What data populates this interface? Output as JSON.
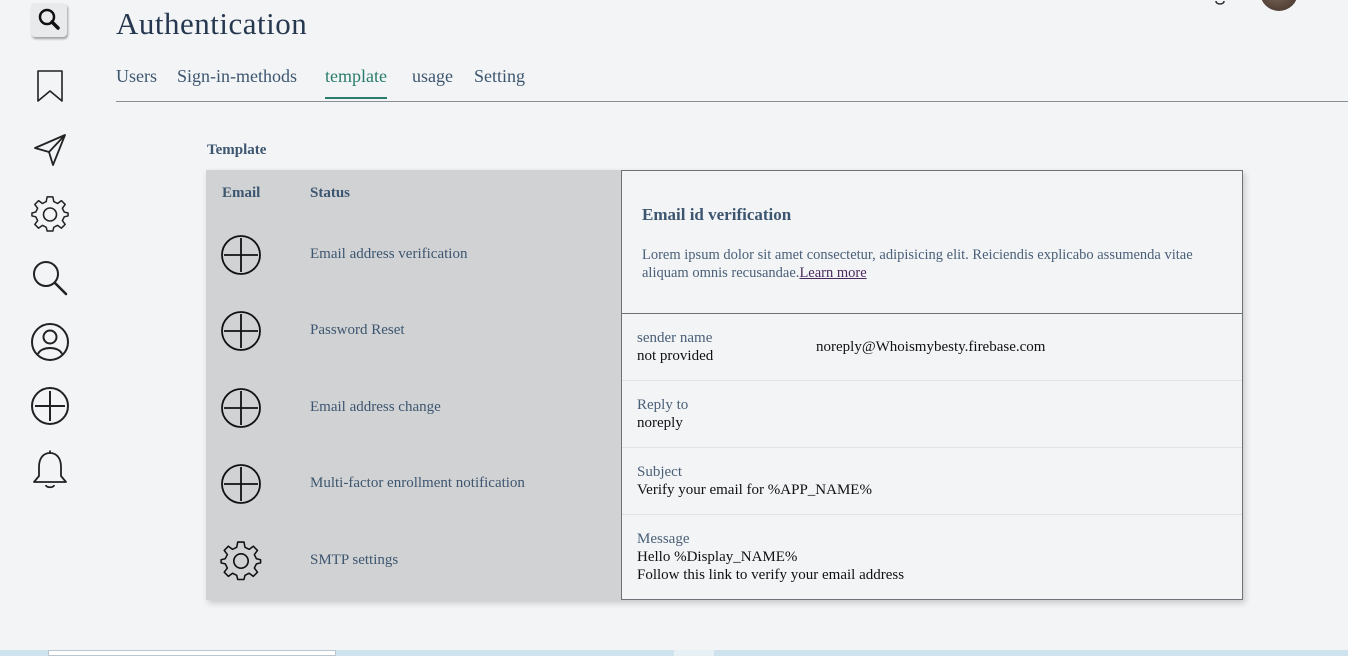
{
  "header": {
    "title": "Authentication"
  },
  "tabs": [
    {
      "label": "Users"
    },
    {
      "label": "Sign-in-methods"
    },
    {
      "label": "template"
    },
    {
      "label": "usage"
    },
    {
      "label": "Setting"
    }
  ],
  "active_tab": "template",
  "rail": {
    "icons": [
      "search-icon",
      "bookmark-icon",
      "send-icon",
      "gear-icon",
      "search-icon",
      "user-icon",
      "add-icon",
      "bell-icon"
    ]
  },
  "section": {
    "label": "Template"
  },
  "template_list": {
    "col_email": "Email",
    "col_status": "Status",
    "rows": [
      {
        "icon": "add-icon",
        "label": "Email address verification"
      },
      {
        "icon": "add-icon",
        "label": "Password Reset"
      },
      {
        "icon": "add-icon",
        "label": "Email address change"
      },
      {
        "icon": "add-icon",
        "label": "Multi-factor enrollment notification"
      },
      {
        "icon": "gear-icon",
        "label": "SMTP settings"
      }
    ]
  },
  "detail": {
    "title": "Email id verification",
    "description": "Lorem ipsum dolor sit amet consectetur, adipisicing elit. Reiciendis explicabo assumenda vitae aliquam omnis recusandae.",
    "learn_more": "Learn more",
    "sender": {
      "label": "sender name",
      "value": "not provided",
      "address": "noreply@Whoismybesty.firebase.com"
    },
    "reply_to": {
      "label": "Reply to",
      "value": "noreply"
    },
    "subject": {
      "label": "Subject",
      "value": "Verify your email for %APP_NAME%"
    },
    "message": {
      "label": "Message",
      "line1": "Hello %Display_NAME%",
      "line2": "Follow this link to verify your email address"
    }
  },
  "colors": {
    "accent": "#2a7d6e",
    "panel_left_bg": "#d1d2d4",
    "page_bg": "#f3f4f6",
    "text": "#3d5670"
  }
}
